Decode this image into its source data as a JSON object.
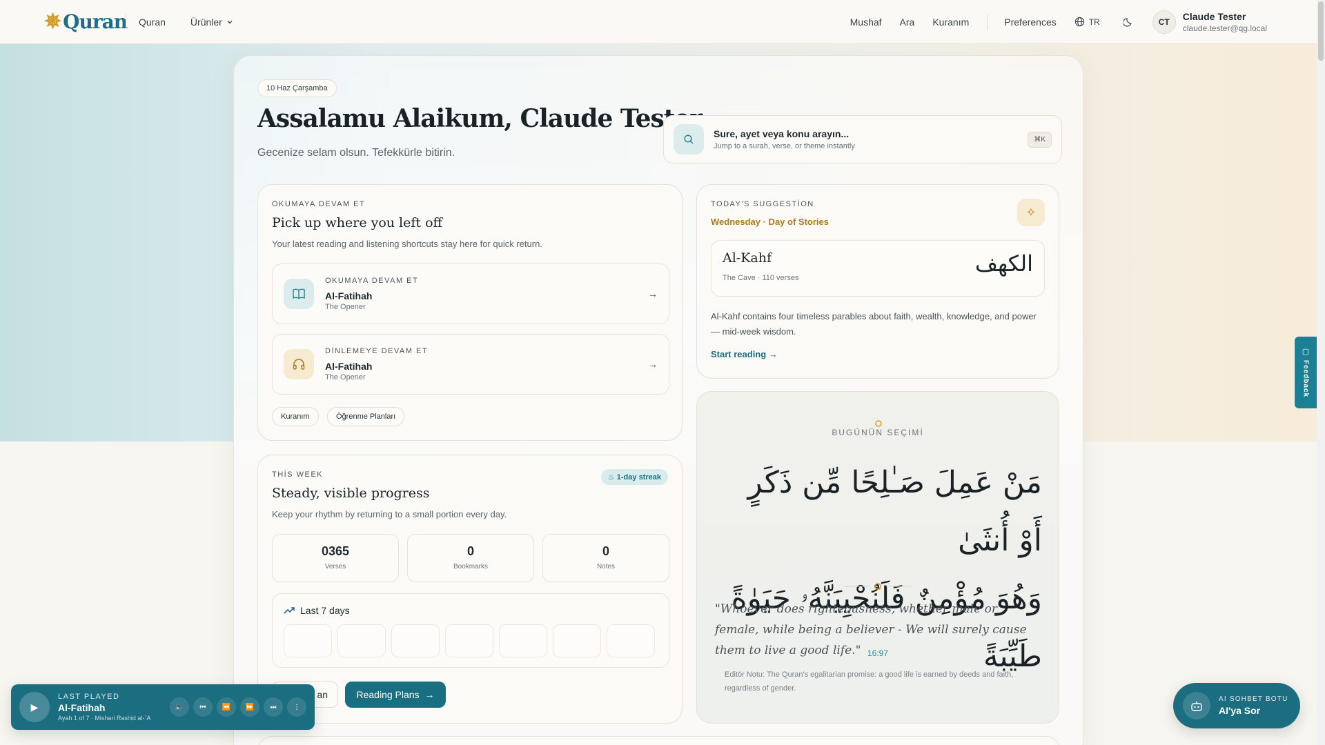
{
  "nav": {
    "logo_text": "Quran",
    "links": [
      "Quran",
      "Ürünler"
    ],
    "right_links": [
      "Mushaf",
      "Ara",
      "Kuranım"
    ],
    "preferences": "Preferences",
    "language": "TR",
    "user": {
      "initials": "CT",
      "name": "Claude Tester",
      "email": "claude.tester@qg.local"
    }
  },
  "header": {
    "date": "10 Haz Çarşamba",
    "greeting": "Assalamu Alaikum, Claude Tester",
    "subtitle": "Gecenize selam olsun. Tefekkürle bitirin."
  },
  "search": {
    "title": "Sure, ayet veya konu arayın...",
    "subtitle": "Jump to a surah, verse, or theme instantly",
    "shortcut": "⌘K"
  },
  "continue_card": {
    "eyebrow": "OKUMAYA DEVAM ET",
    "title": "Pick up where you left off",
    "desc": "Your latest reading and listening shortcuts stay here for quick return.",
    "items": [
      {
        "eyebrow": "OKUMAYA DEVAM ET",
        "name": "Al-Fatihah",
        "sub": "The Opener"
      },
      {
        "eyebrow": "DİNLEMEYE DEVAM ET",
        "name": "Al-Fatihah",
        "sub": "The Opener"
      }
    ],
    "chips": [
      "Kuranım",
      "Öğrenme Planları"
    ]
  },
  "week_card": {
    "eyebrow": "THİS WEEK",
    "title": "Steady, visible progress",
    "desc": "Keep your rhythm by returning to a small portion every day.",
    "streak": "1-day streak",
    "stats": [
      {
        "value": "0365",
        "label": "Verses"
      },
      {
        "value": "0",
        "label": "Bookmarks"
      },
      {
        "value": "0",
        "label": "Notes"
      }
    ],
    "last7_title": "Last 7 days",
    "btn_outline": "an",
    "btn_primary": "Reading Plans"
  },
  "suggestion": {
    "eyebrow": "TODAY'S SUGGESTİON",
    "label": "Wednesday · Day of Stories",
    "surah_name": "Al-Kahf",
    "surah_sub": "The Cave · 110 verses",
    "surah_arabic": "الكهف",
    "desc": "Al-Kahf contains four timeless parables about faith, wealth, knowledge, and power — mid-week wisdom.",
    "cta": "Start reading"
  },
  "ayah": {
    "label": "BUGÜNÜN SEÇİMİ",
    "arabic_line1": "مَنْ عَمِلَ صَـٰلِحًا مِّن ذَكَرٍ أَوْ أُنثَىٰ",
    "arabic_line2": "وَهُوَ مُؤْمِنٌ فَلَنُحْيِيَنَّهُۥ حَيَوٰةً طَيِّبَةً",
    "translation": "\"Whoever does righteousness, whether male or female, while being a believer - We will surely cause them to live a good life.\"",
    "ref": "16:97",
    "note": "Editör Notu: The Quran's egalitarian promise: a good life is earned by deeds and faith, regardless of gender."
  },
  "player": {
    "eyebrow": "LAST PLAYED",
    "name": "Al-Fatihah",
    "sub": "Ayah 1 of 7 · Mishari Rashid al-`A"
  },
  "feedback": "Feedback",
  "ai": {
    "eyebrow": "AI SOHBET BOTU",
    "name": "AI'ya Sor"
  },
  "colors": {
    "accent": "#1a6e82",
    "gold": "#a9791c",
    "streak_bg": "#d8ecee"
  }
}
